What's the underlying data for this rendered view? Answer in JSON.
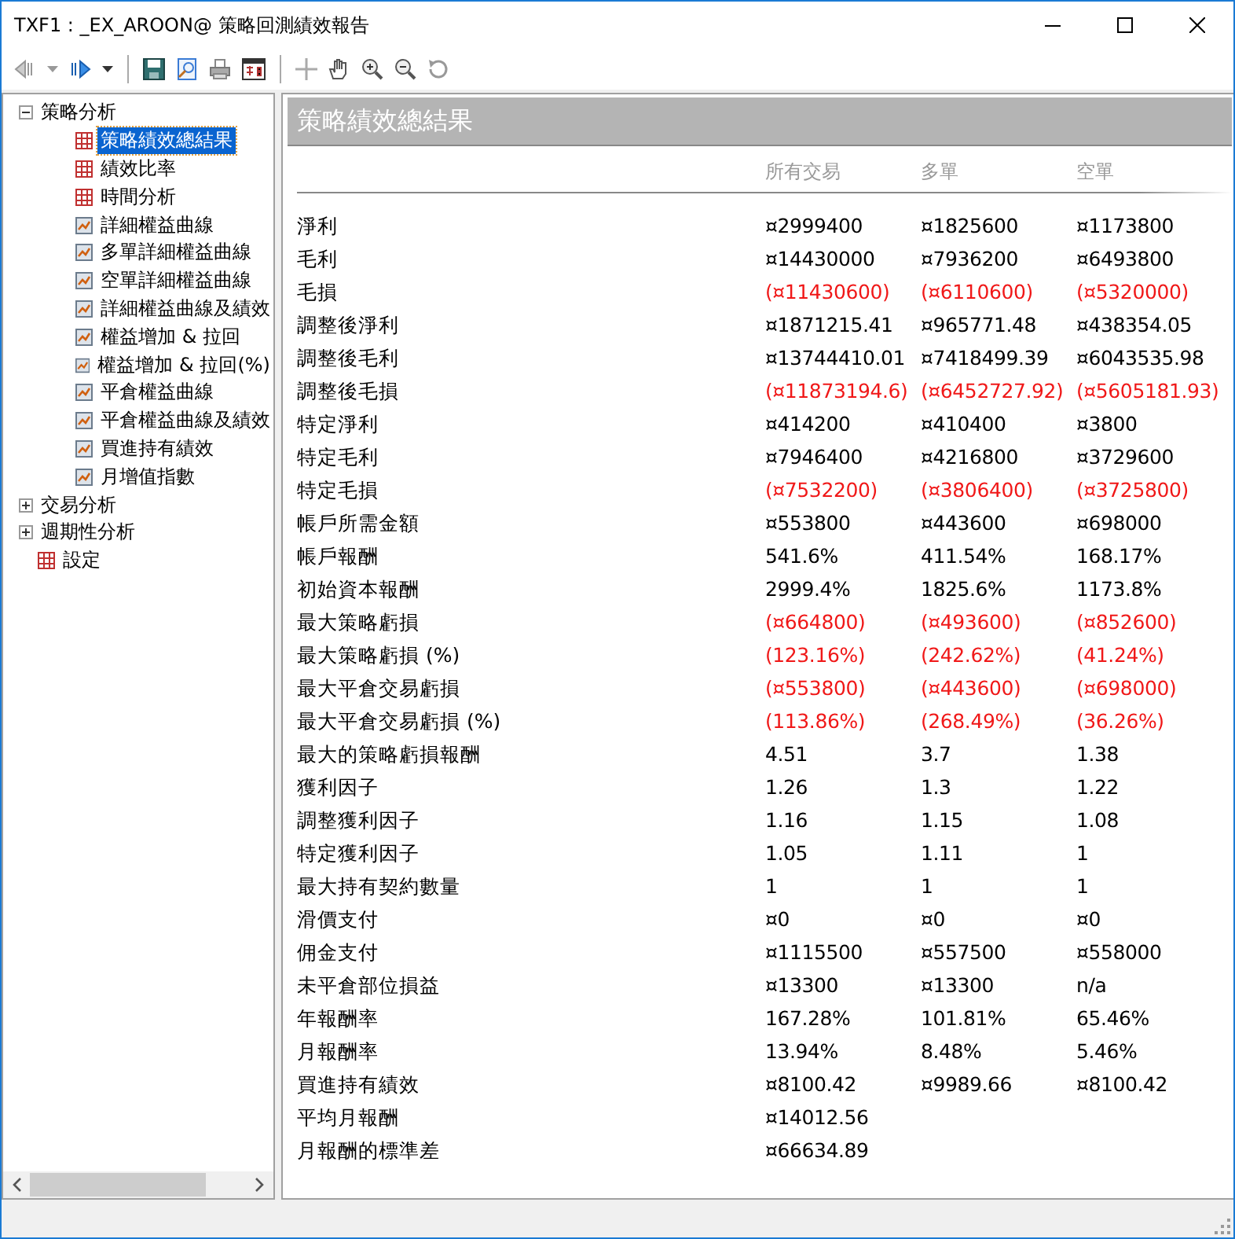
{
  "window": {
    "title": "TXF1 : _EX_AROON@ 策略回測績效報告"
  },
  "tree": [
    {
      "label": "策略分析",
      "kind": "folder",
      "expanded": true,
      "selected": false,
      "children": [
        {
          "label": "策略績效總結果",
          "kind": "table",
          "selected": true
        },
        {
          "label": "績效比率",
          "kind": "table",
          "selected": false
        },
        {
          "label": "時間分析",
          "kind": "table",
          "selected": false
        },
        {
          "label": "詳細權益曲線",
          "kind": "chart",
          "selected": false
        },
        {
          "label": "多單詳細權益曲線",
          "kind": "chart",
          "selected": false
        },
        {
          "label": "空單詳細權益曲線",
          "kind": "chart",
          "selected": false
        },
        {
          "label": "詳細權益曲線及績效",
          "kind": "chart",
          "selected": false
        },
        {
          "label": "權益增加 & 拉回",
          "kind": "chart",
          "selected": false
        },
        {
          "label": "權益增加 & 拉回(%)",
          "kind": "chart",
          "selected": false
        },
        {
          "label": "平倉權益曲線",
          "kind": "chart",
          "selected": false
        },
        {
          "label": "平倉權益曲線及績效",
          "kind": "chart",
          "selected": false
        },
        {
          "label": "買進持有績效",
          "kind": "chart",
          "selected": false
        },
        {
          "label": "月增值指數",
          "kind": "chart",
          "selected": false
        }
      ]
    },
    {
      "label": "交易分析",
      "kind": "folder",
      "expanded": false,
      "selected": false
    },
    {
      "label": "週期性分析",
      "kind": "folder",
      "expanded": false,
      "selected": false
    },
    {
      "label": "設定",
      "kind": "table",
      "selected": false
    }
  ],
  "report": {
    "title": "策略績效總結果",
    "columns": [
      "所有交易",
      "多單",
      "空單"
    ],
    "rows": [
      {
        "label": "淨利",
        "negative": false,
        "values": [
          "¤2999400",
          "¤1825600",
          "¤1173800"
        ]
      },
      {
        "label": "毛利",
        "negative": false,
        "values": [
          "¤14430000",
          "¤7936200",
          "¤6493800"
        ]
      },
      {
        "label": "毛損",
        "negative": true,
        "values": [
          "(¤11430600)",
          "(¤6110600)",
          "(¤5320000)"
        ]
      },
      {
        "label": "調整後淨利",
        "negative": false,
        "values": [
          "¤1871215.41",
          "¤965771.48",
          "¤438354.05"
        ]
      },
      {
        "label": "調整後毛利",
        "negative": false,
        "values": [
          "¤13744410.01",
          "¤7418499.39",
          "¤6043535.98"
        ]
      },
      {
        "label": "調整後毛損",
        "negative": true,
        "values": [
          "(¤11873194.6)",
          "(¤6452727.92)",
          "(¤5605181.93)"
        ]
      },
      {
        "label": "特定淨利",
        "negative": false,
        "values": [
          "¤414200",
          "¤410400",
          "¤3800"
        ]
      },
      {
        "label": "特定毛利",
        "negative": false,
        "values": [
          "¤7946400",
          "¤4216800",
          "¤3729600"
        ]
      },
      {
        "label": "特定毛損",
        "negative": true,
        "values": [
          "(¤7532200)",
          "(¤3806400)",
          "(¤3725800)"
        ]
      },
      {
        "label": "帳戶所需金額",
        "negative": false,
        "values": [
          "¤553800",
          "¤443600",
          "¤698000"
        ]
      },
      {
        "label": "帳戶報酬",
        "negative": false,
        "values": [
          "541.6%",
          "411.54%",
          "168.17%"
        ]
      },
      {
        "label": "初始資本報酬",
        "negative": false,
        "values": [
          "2999.4%",
          "1825.6%",
          "1173.8%"
        ]
      },
      {
        "label": "最大策略虧損",
        "negative": true,
        "values": [
          "(¤664800)",
          "(¤493600)",
          "(¤852600)"
        ]
      },
      {
        "label": "最大策略虧損 (%)",
        "negative": true,
        "values": [
          "(123.16%)",
          "(242.62%)",
          "(41.24%)"
        ]
      },
      {
        "label": "最大平倉交易虧損",
        "negative": true,
        "values": [
          "(¤553800)",
          "(¤443600)",
          "(¤698000)"
        ]
      },
      {
        "label": "最大平倉交易虧損 (%)",
        "negative": true,
        "values": [
          "(113.86%)",
          "(268.49%)",
          "(36.26%)"
        ]
      },
      {
        "label": "最大的策略虧損報酬",
        "negative": false,
        "values": [
          "4.51",
          "3.7",
          "1.38"
        ]
      },
      {
        "label": "獲利因子",
        "negative": false,
        "values": [
          "1.26",
          "1.3",
          "1.22"
        ]
      },
      {
        "label": "調整獲利因子",
        "negative": false,
        "values": [
          "1.16",
          "1.15",
          "1.08"
        ]
      },
      {
        "label": "特定獲利因子",
        "negative": false,
        "values": [
          "1.05",
          "1.11",
          "1"
        ]
      },
      {
        "label": "最大持有契約數量",
        "negative": false,
        "values": [
          "1",
          "1",
          "1"
        ]
      },
      {
        "label": "滑價支付",
        "negative": false,
        "values": [
          "¤0",
          "¤0",
          "¤0"
        ]
      },
      {
        "label": "佣金支付",
        "negative": false,
        "values": [
          "¤1115500",
          "¤557500",
          "¤558000"
        ]
      },
      {
        "label": "未平倉部位損益",
        "negative": false,
        "values": [
          "¤13300",
          "¤13300",
          "n/a"
        ]
      },
      {
        "label": "年報酬率",
        "negative": false,
        "values": [
          "167.28%",
          "101.81%",
          "65.46%"
        ]
      },
      {
        "label": "月報酬率",
        "negative": false,
        "values": [
          "13.94%",
          "8.48%",
          "5.46%"
        ]
      },
      {
        "label": "買進持有績效",
        "negative": false,
        "values": [
          "¤8100.42",
          "¤9989.66",
          "¤8100.42"
        ]
      },
      {
        "label": "平均月報酬",
        "negative": false,
        "values": [
          "¤14012.56"
        ]
      },
      {
        "label": "月報酬的標準差",
        "negative": false,
        "values": [
          "¤66634.89"
        ]
      }
    ]
  }
}
